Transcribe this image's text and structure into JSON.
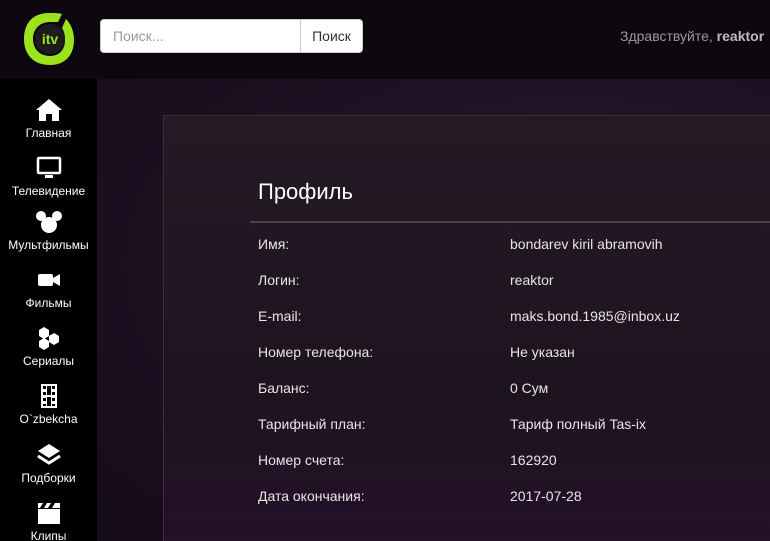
{
  "header": {
    "logo_text": "itv",
    "search": {
      "placeholder": "Поиск...",
      "value": "",
      "button_label": "Поиск"
    },
    "greeting_prefix": "Здравствуйте,",
    "username": "reaktor"
  },
  "sidebar": {
    "items": [
      {
        "label": "Главная",
        "icon": "home-icon"
      },
      {
        "label": "Телевидение",
        "icon": "tv-icon"
      },
      {
        "label": "Мультфильмы",
        "icon": "mickey-icon"
      },
      {
        "label": "Фильмы",
        "icon": "video-camera-icon"
      },
      {
        "label": "Сериалы",
        "icon": "hexagons-icon"
      },
      {
        "label": "O`zbekcha",
        "icon": "film-strip-icon"
      },
      {
        "label": "Подборки",
        "icon": "layers-icon"
      },
      {
        "label": "Клипы",
        "icon": "clapperboard-icon"
      }
    ]
  },
  "profile": {
    "title": "Профиль",
    "rows": [
      {
        "label": "Имя:",
        "value": "bondarev kiril abramovih"
      },
      {
        "label": "Логин:",
        "value": "reaktor"
      },
      {
        "label": "E-mail:",
        "value": "maks.bond.1985@inbox.uz"
      },
      {
        "label": "Номер телефона:",
        "value": "Не указан"
      },
      {
        "label": "Баланс:",
        "value": "0 Сум"
      },
      {
        "label": "Тарифный план:",
        "value": "Тариф полный Tas-ix"
      },
      {
        "label": "Номер счета:",
        "value": "162920"
      },
      {
        "label": "Дата окончания:",
        "value": "2017-07-28"
      }
    ]
  },
  "colors": {
    "accent_green": "#9be31c",
    "logo_dark": "#1a1a1a"
  }
}
